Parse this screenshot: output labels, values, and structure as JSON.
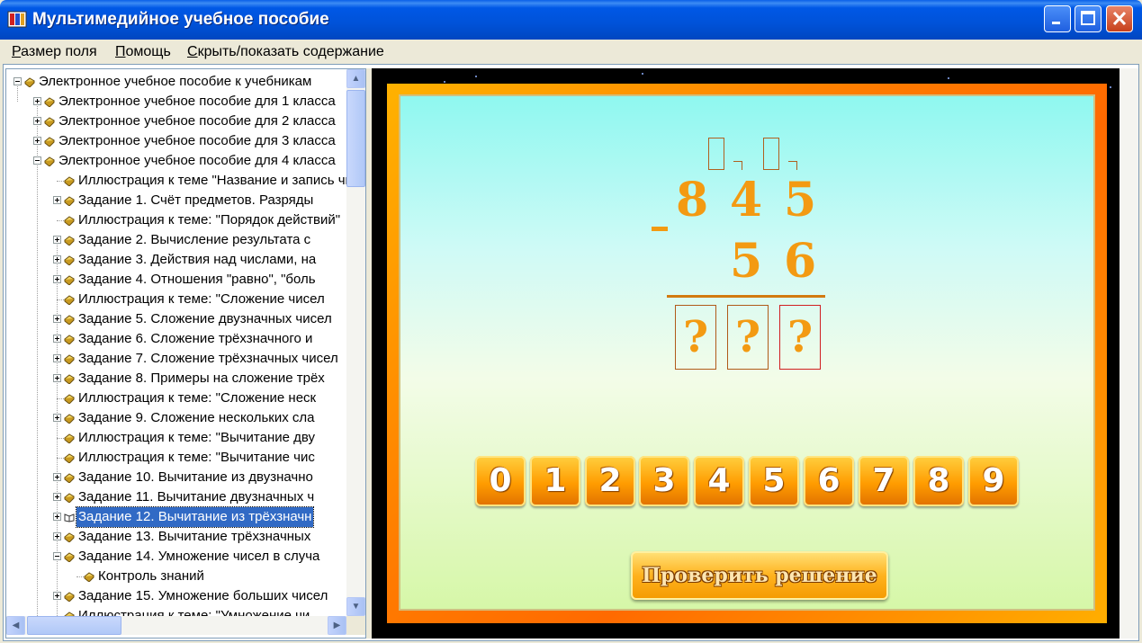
{
  "window": {
    "title": "Мультимедийное учебное пособие",
    "controls": [
      "minimize-icon",
      "maximize-icon",
      "close-icon"
    ]
  },
  "menu": {
    "items": [
      {
        "label_ul": "Р",
        "label_rest": "азмер поля"
      },
      {
        "label_ul": "П",
        "label_rest": "омощь"
      },
      {
        "label_ul": "С",
        "label_rest": "крыть/показать содержание"
      }
    ]
  },
  "tree": {
    "items": [
      {
        "label": "Электронное учебное пособие к учебникам",
        "level": 0,
        "expander": "minus"
      },
      {
        "label": "Электронное учебное пособие для 1 класса",
        "level": 1,
        "expander": "plus"
      },
      {
        "label": "Электронное учебное пособие для 2 класса",
        "level": 1,
        "expander": "plus"
      },
      {
        "label": "Электронное учебное пособие для 3 класса",
        "level": 1,
        "expander": "plus"
      },
      {
        "label": "Электронное учебное пособие для 4 класса",
        "level": 1,
        "expander": "minus"
      },
      {
        "label": "Иллюстрация к теме \"Название и запись чисел\"",
        "level": 2,
        "expander": "none"
      },
      {
        "label": "Задание 1. Счёт предметов. Разряды",
        "level": 2,
        "expander": "plus"
      },
      {
        "label": "Иллюстрация к теме: \"Порядок действий\"",
        "level": 2,
        "expander": "none"
      },
      {
        "label": "Задание 2. Вычисление результата с",
        "level": 2,
        "expander": "plus"
      },
      {
        "label": "Задание 3. Действия над числами, на",
        "level": 2,
        "expander": "plus"
      },
      {
        "label": "Задание 4. Отношения \"равно\", \"боль",
        "level": 2,
        "expander": "plus"
      },
      {
        "label": "Иллюстрация к теме: \"Сложение чисел",
        "level": 2,
        "expander": "none"
      },
      {
        "label": "Задание 5. Сложение двузначных чисел",
        "level": 2,
        "expander": "plus"
      },
      {
        "label": "Задание 6. Сложение трёхзначного и",
        "level": 2,
        "expander": "plus"
      },
      {
        "label": "Задание 7. Сложение трёхзначных чисел",
        "level": 2,
        "expander": "plus"
      },
      {
        "label": "Задание 8. Примеры на сложение трёх",
        "level": 2,
        "expander": "plus"
      },
      {
        "label": "Иллюстрация к теме: \"Сложение неск",
        "level": 2,
        "expander": "none"
      },
      {
        "label": "Задание 9. Сложение нескольких сла",
        "level": 2,
        "expander": "plus"
      },
      {
        "label": "Иллюстрация к теме: \"Вычитание дву",
        "level": 2,
        "expander": "none"
      },
      {
        "label": "Иллюстрация к теме: \"Вычитание чис",
        "level": 2,
        "expander": "none"
      },
      {
        "label": "Задание 10. Вычитание из двузначно",
        "level": 2,
        "expander": "plus"
      },
      {
        "label": "Задание 11. Вычитание двузначных ч",
        "level": 2,
        "expander": "plus"
      },
      {
        "label": "Задание 12. Вычитание из трёхзначн",
        "level": 2,
        "expander": "plus",
        "selected": true
      },
      {
        "label": "Задание 13. Вычитание трёхзначных",
        "level": 2,
        "expander": "plus"
      },
      {
        "label": "Задание 14. Умножение чисел в случа",
        "level": 2,
        "expander": "minus"
      },
      {
        "label": "Контроль знаний",
        "level": 3,
        "expander": "none"
      },
      {
        "label": "Задание 15. Умножение больших чисел",
        "level": 2,
        "expander": "plus"
      },
      {
        "label": "Иллюстрация к теме: \"Умножение чи",
        "level": 2,
        "expander": "none"
      }
    ]
  },
  "exercise": {
    "operator": "-",
    "minuend": [
      "8",
      "4",
      "5"
    ],
    "subtrahend": [
      "5",
      "6"
    ],
    "answer": [
      "?",
      "?",
      "?"
    ],
    "digits": [
      "0",
      "1",
      "2",
      "3",
      "4",
      "5",
      "6",
      "7",
      "8",
      "9"
    ],
    "check_button": "Проверить решение"
  },
  "colors": {
    "accent": "#f39a12",
    "selection": "#316ac5",
    "board_frame": "#ff7a00"
  }
}
